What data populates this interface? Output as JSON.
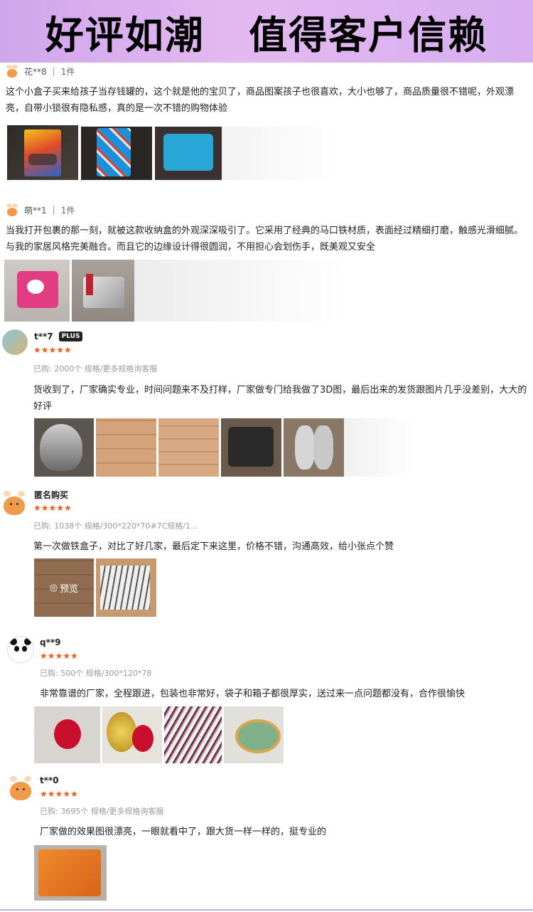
{
  "banner": {
    "text": "好评如潮   值得客户信赖"
  },
  "colors": {
    "accent_orange": "#f05a1a",
    "banner_purple": "#d7aef0"
  },
  "reviews": [
    {
      "user": "花**8",
      "count": "1件",
      "text": "这个小盒子买来给孩子当存钱罐的，这个就是他的宝贝了，商品图案孩子也很喜欢，大小也够了，商品质量很不错呢，外观漂亮，自带小锁很有隐私感，真的是一次不错的购物体验"
    },
    {
      "user": "萌**1",
      "count": "1件",
      "text": "当我打开包裹的那一刻，就被这款收纳盒的外观深深吸引了。它采用了经典的马口铁材质，表面经过精细打磨，触感光滑细腻。与我的家居风格完美融合。而且它的边缘设计得很圆润，不用担心会划伤手，既美观又安全"
    },
    {
      "user": "t**7",
      "badge": "PLUS",
      "stars": "★★★★★",
      "spec": "已购: 2000个 规格/更多规格询客服",
      "text": "货收到了，厂家确实专业，时间问题来不及打样，厂家做专门给我做了3D图，最后出来的发货跟图片几乎没差别，大大的好评"
    },
    {
      "user": "匿名购买",
      "stars": "★★★★★",
      "spec": "已购: 1038个 规格/300*220*70#7C规格/1...",
      "text": "第一次做铁盒子，对比了好几家，最后定下来这里，价格不错，沟通高效，给小张点个赞",
      "preview": "预览"
    },
    {
      "user": "q**9",
      "stars": "★★★★★",
      "spec": "已购: 500个 规格/300*120*78",
      "text": "非常靠谱的厂家，全程跟进，包装也非常好，袋子和箱子都很厚实，送过来一点问题都没有，合作很愉快"
    },
    {
      "user": "t**0",
      "stars": "★★★★★",
      "spec": "已购: 3695个 规格/更多规格询客服",
      "text": "厂家做的效果图很漂亮，一眼就看中了，跟大货一样一样的，挺专业的"
    }
  ]
}
